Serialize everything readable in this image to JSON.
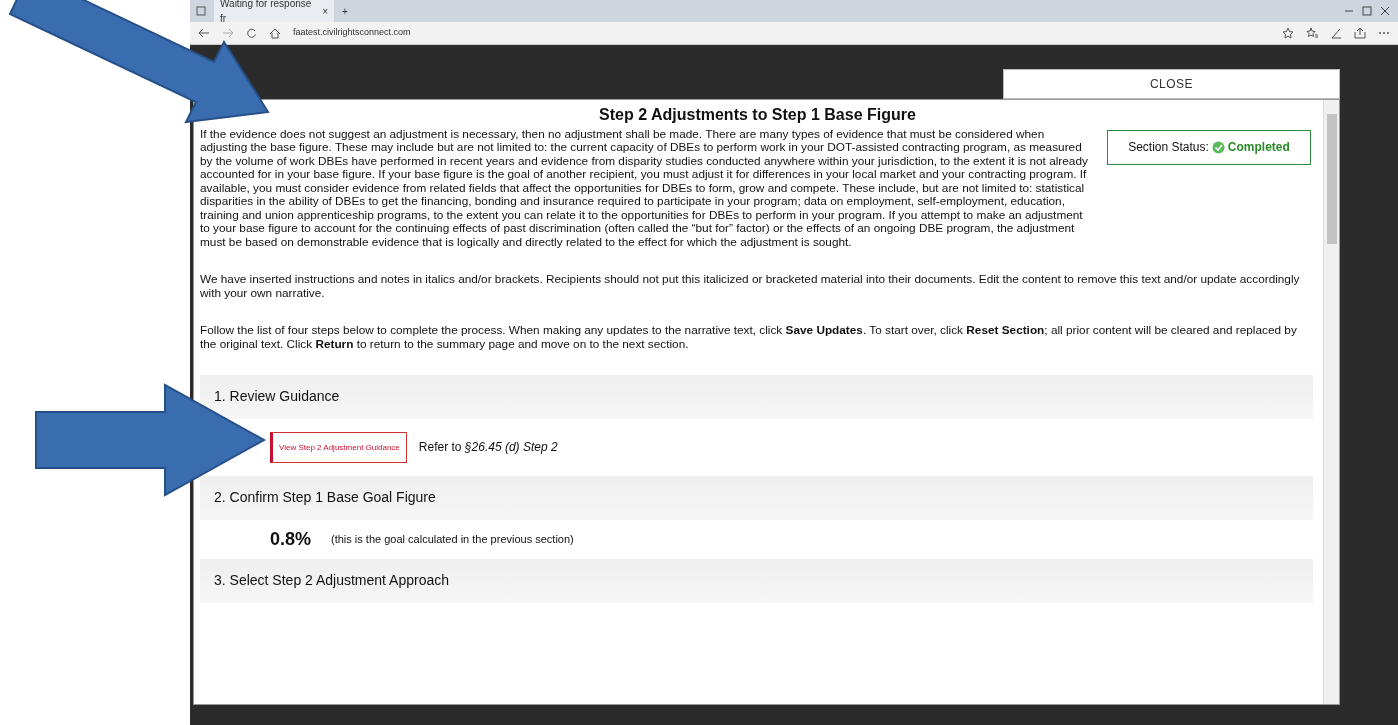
{
  "browser": {
    "tab_title": "Waiting for response fr",
    "tab_close": "×",
    "new_tab": "+",
    "url": "faatest.civilrightsconnect.com"
  },
  "close_label": "CLOSE",
  "modal": {
    "title": "Step 2 Adjustments to Step 1 Base Figure",
    "section_status": {
      "label": "Section Status:",
      "value": "Completed",
      "completed": true
    },
    "paragraphs": [
      "If the evidence does not suggest an adjustment is necessary, then no adjustment shall be made. There are many types of evidence that must be considered when adjusting the base figure. These may include but are not limited to: the current capacity of DBEs to perform work in your DOT-assisted contracting program, as measured by the volume of work DBEs have performed in recent years and evidence from disparity studies conducted anywhere within your jurisdiction, to the extent it is not already accounted for in your base figure. If your base figure is the goal of another recipient, you must adjust it for differences in your local market and your contracting program. If available, you must consider evidence from related fields that affect the opportunities for DBEs to form, grow and compete. These include, but are not limited to: statistical disparities in the ability of DBEs to get the financing, bonding and insurance required to participate in your program; data on employment, self-employment, education, training and union apprenticeship programs, to the extent you can relate it to the opportunities for DBEs to perform in your program. If you attempt to make an adjustment to your base figure to account for the continuing effects of past discrimination (often called the “but for” factor) or the effects of an ongoing DBE program, the adjustment must be based on demonstrable evidence that is logically and directly related to the effect for which the adjustment is sought.",
      "We have inserted instructions and notes in italics and/or brackets. Recipients should not put this italicized or bracketed material into their documents. Edit the content to remove this text and/or update accordingly with your own narrative.",
      "Follow the list of four steps below to complete the process. When making any updates to the narrative text, click **Save Updates**. To start over, click **Reset Section**; all prior content will be cleared and replaced by the original text. Click **Return** to return to the summary page and move on to the next section."
    ],
    "steps": [
      {
        "kind": "guidance",
        "title": "1. Review Guidance",
        "button": "View Step 2 Adjustment Guidance",
        "reference": "Refer to *§26.45 (d) Step 2*"
      },
      {
        "kind": "figure",
        "title": "2. Confirm Step 1 Base Goal Figure",
        "value": "0.8%",
        "note": "(this is the goal calculated in the previous section)"
      },
      {
        "kind": "heading",
        "title": "3. Select Step 2 Adjustment Approach"
      }
    ]
  }
}
